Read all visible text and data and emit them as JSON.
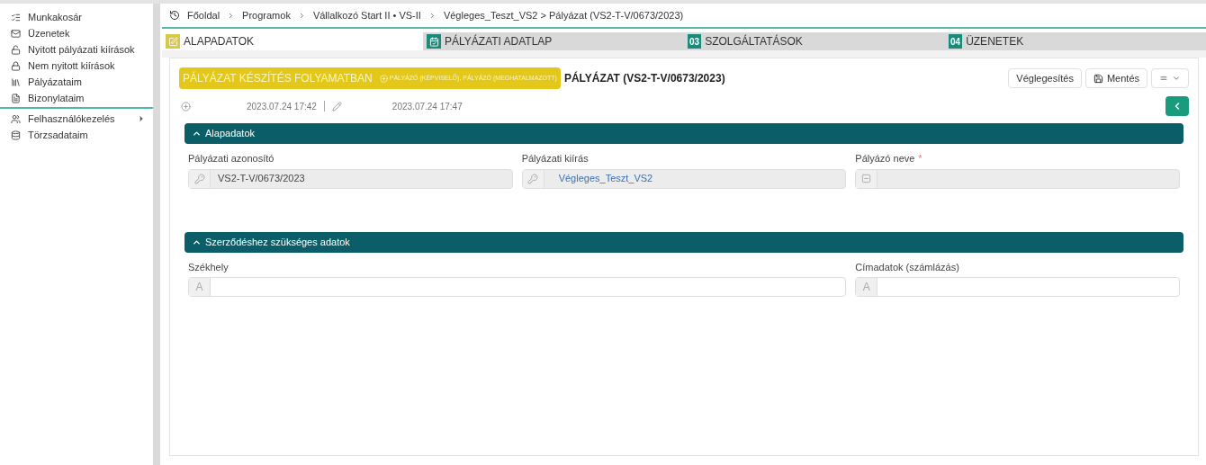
{
  "sidebar": {
    "items": [
      {
        "label": "Munkakosár",
        "has_submenu": false
      },
      {
        "label": "Üzenetek",
        "has_submenu": false
      },
      {
        "label": "Nyitott pályázati kiírások",
        "has_submenu": false
      },
      {
        "label": "Nem nyitott kiírások",
        "has_submenu": false
      },
      {
        "label": "Pályázataim",
        "has_submenu": false
      },
      {
        "label": "Bizonylataim",
        "has_submenu": false
      },
      {
        "label": "Felhasználókezelés",
        "has_submenu": true
      },
      {
        "label": "Törzsadataim",
        "has_submenu": false
      }
    ]
  },
  "breadcrumb": [
    "Főoldal",
    "Programok",
    "Vállalkozó Start II • VS-II",
    "Végleges_Teszt_VS2 > Pályázat (VS2-T-V/0673/2023)"
  ],
  "tabs": [
    {
      "label": "ALAPADATOK",
      "selected": true
    },
    {
      "label": "PÁLYÁZATI ADATLAP",
      "selected": false
    },
    {
      "label": "SZOLGÁLTATÁSOK",
      "badge": "03",
      "selected": false
    },
    {
      "label": "ÜZENETEK",
      "badge": "04",
      "selected": false
    }
  ],
  "status": {
    "label": "PÁLYÁZAT KÉSZÍTÉS FOLYAMATBAN",
    "roles": "PÁLYÁZÓ (KÉPVISELŐ), PÁLYÁZÓ (MEGHATALMAZOTT)"
  },
  "title": "PÁLYÁZAT (VS2-T-V/0673/2023)",
  "actions": [
    {
      "label": "Véglegesítés"
    },
    {
      "label": "Mentés"
    }
  ],
  "created": "2023.07.24 17:42",
  "modified": "2023.07.24 17:47",
  "sections": [
    {
      "title": "Alapadatok",
      "expanded": true,
      "fields": [
        {
          "label": "Pályázati azonosító",
          "value": "VS2-T-V/0673/2023",
          "readonly": true
        },
        {
          "label": "Pályázati kiírás",
          "value": "Végleges_Teszt_VS2",
          "readonly": true
        },
        {
          "label": "Pályázó neve",
          "required_mark": "*",
          "readonly": true
        }
      ]
    },
    {
      "title": "Szerződéshez szükséges adatok",
      "expanded": true,
      "fields": [
        {
          "label": "Székhely",
          "prefix": "A",
          "readonly": false
        },
        {
          "label": "Címadatok (számlázás)",
          "prefix": "A",
          "readonly": false
        }
      ]
    }
  ]
}
